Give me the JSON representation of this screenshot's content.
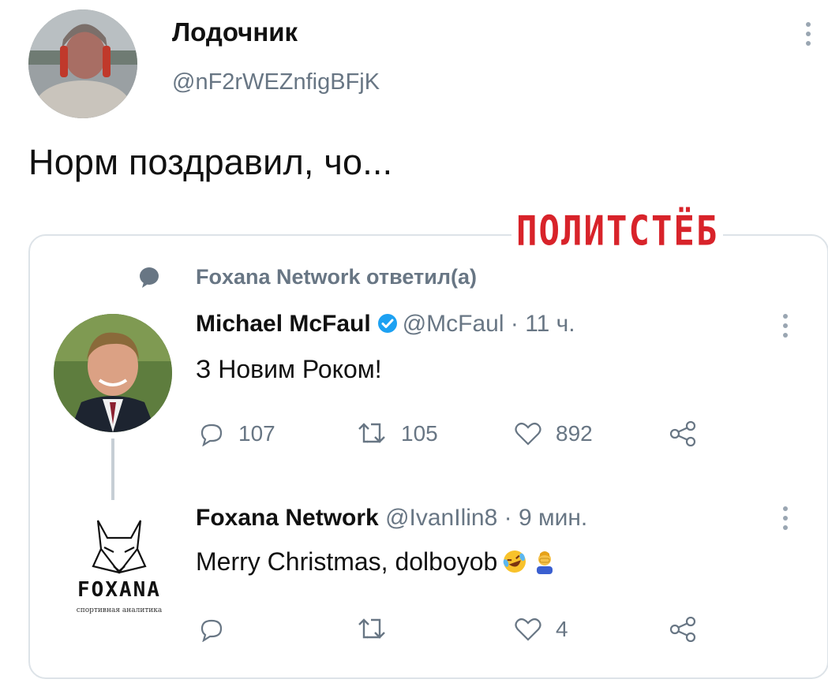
{
  "author": {
    "name": "Лодочник",
    "handle": "@nF2rWEZnfigBFjK"
  },
  "tweet": {
    "text": "Норм поздравил, чо..."
  },
  "watermark": "ПОЛИТСТЁБ",
  "quote": {
    "reply_context": "Foxana Network ответил(а)",
    "original": {
      "name": "Michael McFaul",
      "handle": "@McFaul",
      "time": "· 11 ч.",
      "text": "З Новим Роком!",
      "stats": {
        "replies": "107",
        "retweets": "105",
        "likes": "892"
      }
    },
    "reply": {
      "name": "Foxana Network",
      "handle": "@IvanIlin8",
      "time": "· 9 мин.",
      "text": "Merry Christmas, dolboyob",
      "stats": {
        "likes": "4"
      },
      "logo_text": "FOXANA",
      "logo_subtext": "спортивная аналитика"
    }
  },
  "colors": {
    "verified": "#1da1f2",
    "muted": "#687684",
    "watermark": "#d8232a"
  },
  "icons": [
    "more-vertical-icon",
    "speech-bubble-icon",
    "verified-badge-icon",
    "reply-icon",
    "retweet-icon",
    "like-icon",
    "share-icon",
    "rofl-emoji-icon",
    "facepalm-emoji-icon",
    "fox-logo-icon"
  ]
}
